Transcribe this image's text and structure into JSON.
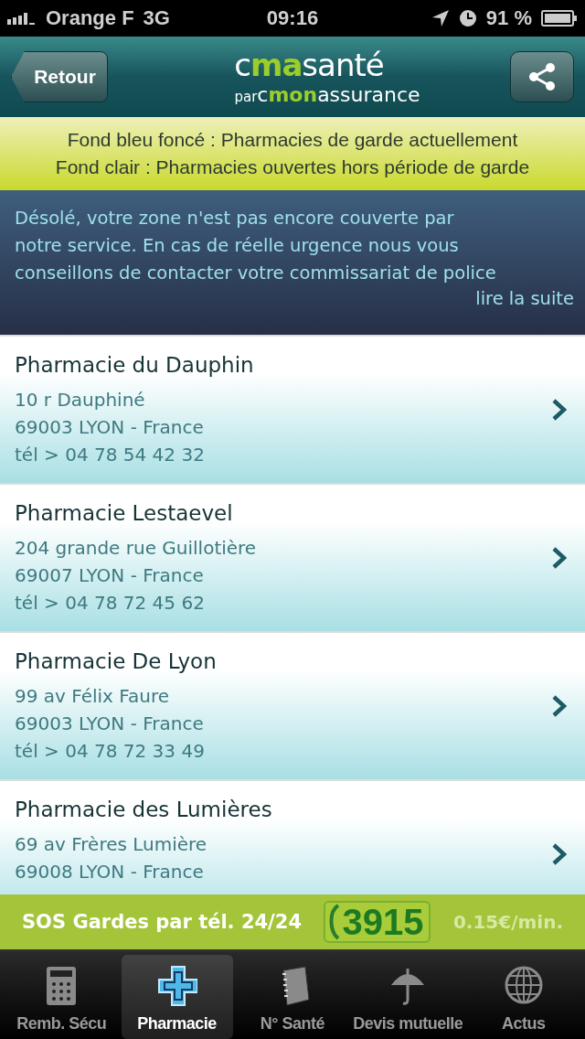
{
  "status_bar": {
    "carrier": "Orange F",
    "network": "3G",
    "time": "09:16",
    "battery": "91 %"
  },
  "nav_bar": {
    "back": "Retour",
    "logo": [
      {
        "text": "c",
        "accent": false
      },
      {
        "text": "ma",
        "accent": true
      },
      {
        "text": "santé",
        "accent": false
      }
    ],
    "logo_sub": [
      {
        "text": "par",
        "accent": false,
        "small": true
      },
      {
        "text": "c",
        "accent": false,
        "small": false
      },
      {
        "text": "mon",
        "accent": true,
        "small": false
      },
      {
        "text": "assurance",
        "accent": false,
        "small": false
      }
    ]
  },
  "legend": [
    "Fond bleu foncé : Pharmacies de garde actuellement",
    "Fond clair : Pharmacies ouvertes hors période de garde"
  ],
  "notice": {
    "text": "Désolé, votre zone n'est pas encore couverte par notre service. En cas de réelle urgence nous vous conseillons de contacter votre commissariat de police",
    "link": "lire la suite"
  },
  "pharmacies": [
    {
      "name": "Pharmacie du Dauphin",
      "lines": [
        "10 r Dauphiné",
        "69003 LYON - France",
        "tél > 04 78 54 42 32"
      ]
    },
    {
      "name": "Pharmacie Lestaevel",
      "lines": [
        "204 grande rue Guillotière",
        "69007 LYON - France",
        "tél > 04 78 72 45 62"
      ]
    },
    {
      "name": "Pharmacie De Lyon",
      "lines": [
        "99 av Félix Faure",
        "69003 LYON - France",
        "tél > 04 78 72 33 49"
      ]
    },
    {
      "name": "Pharmacie des Lumières",
      "lines": [
        "69 av Frères Lumière",
        "69008 LYON - France"
      ]
    }
  ],
  "sos_bar": {
    "label": "SOS Gardes par tél. 24/24",
    "number": "3915",
    "price": "0.15€/min."
  },
  "tab_bar": [
    {
      "label": "Remb. Sécu",
      "selected": false
    },
    {
      "label": "Pharmacie",
      "selected": true
    },
    {
      "label": "N° Santé",
      "selected": false
    },
    {
      "label": "Devis mutuelle",
      "selected": false
    },
    {
      "label": "Actus",
      "selected": false
    }
  ]
}
